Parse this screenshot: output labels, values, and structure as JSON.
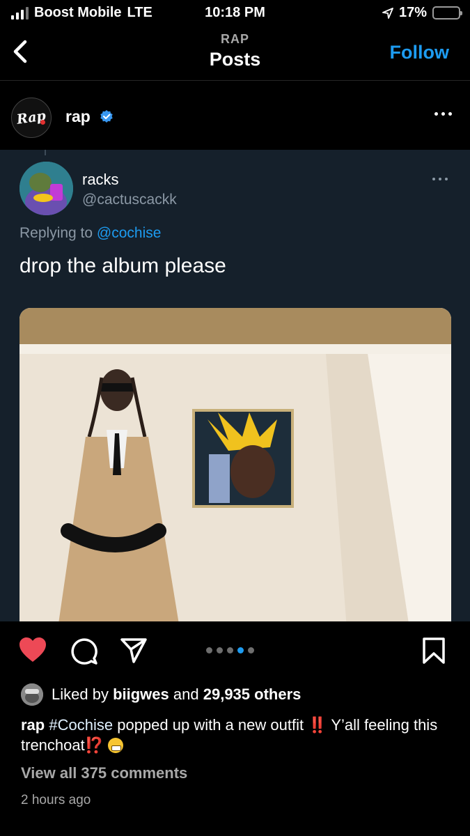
{
  "status_bar": {
    "carrier": "Boost Mobile",
    "network": "LTE",
    "time": "10:18 PM",
    "battery_percent": "17%",
    "battery_level": 0.17,
    "battery_color": "#f5c400"
  },
  "nav": {
    "back_icon": "chevron-left-icon",
    "subtitle": "RAP",
    "title": "Posts",
    "follow_label": "Follow",
    "follow_color": "#1d9bf0"
  },
  "post": {
    "account_name": "rap",
    "avatar_logo": "Rap",
    "verified_icon": "verified-badge-icon",
    "more_icon": "more-horizontal-icon"
  },
  "tweet": {
    "display_name": "racks",
    "handle": "@cactuscackk",
    "replying_prefix": "Replying to",
    "replying_handle": "@cochise",
    "text": "drop the album please",
    "photo_icon": "photo-placeholder"
  },
  "actions": {
    "like_icon": "heart-filled-icon",
    "comment_icon": "comment-icon",
    "share_icon": "send-icon",
    "save_icon": "bookmark-icon",
    "like_color": "#ed4956",
    "carousel_count": 5,
    "carousel_active": 3
  },
  "likes": {
    "prefix": "Liked by",
    "user": "biigwes",
    "middle": "and",
    "count": "29,935 others"
  },
  "caption": {
    "user": "rap",
    "hashtag": "#Cochise",
    "text1": "popped up with a new outfit",
    "bang1": "‼️",
    "text2": "Y’all feeling this trenchoat",
    "bang2": "⁉️"
  },
  "comments_link": "View all 375 comments",
  "time_ago": "2 hours ago"
}
